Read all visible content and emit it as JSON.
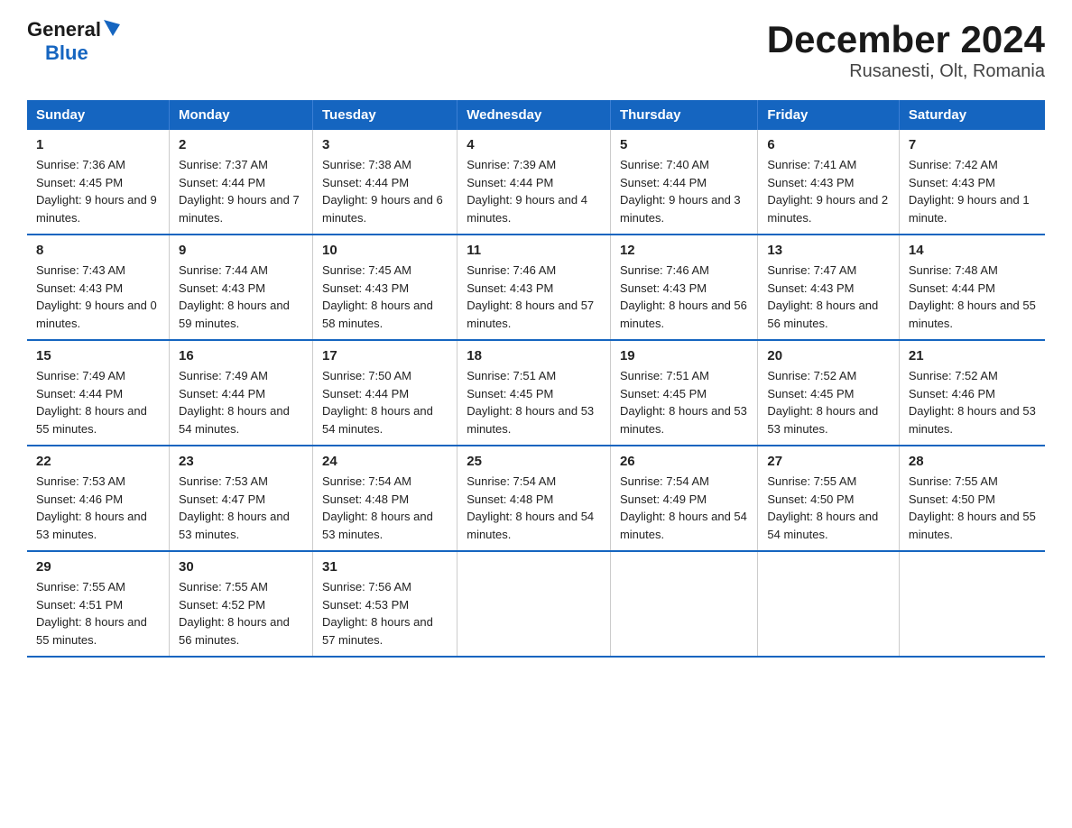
{
  "logo": {
    "general": "General",
    "blue": "Blue"
  },
  "title": "December 2024",
  "subtitle": "Rusanesti, Olt, Romania",
  "headers": [
    "Sunday",
    "Monday",
    "Tuesday",
    "Wednesday",
    "Thursday",
    "Friday",
    "Saturday"
  ],
  "weeks": [
    [
      {
        "day": "1",
        "sunrise": "7:36 AM",
        "sunset": "4:45 PM",
        "daylight": "9 hours and 9 minutes."
      },
      {
        "day": "2",
        "sunrise": "7:37 AM",
        "sunset": "4:44 PM",
        "daylight": "9 hours and 7 minutes."
      },
      {
        "day": "3",
        "sunrise": "7:38 AM",
        "sunset": "4:44 PM",
        "daylight": "9 hours and 6 minutes."
      },
      {
        "day": "4",
        "sunrise": "7:39 AM",
        "sunset": "4:44 PM",
        "daylight": "9 hours and 4 minutes."
      },
      {
        "day": "5",
        "sunrise": "7:40 AM",
        "sunset": "4:44 PM",
        "daylight": "9 hours and 3 minutes."
      },
      {
        "day": "6",
        "sunrise": "7:41 AM",
        "sunset": "4:43 PM",
        "daylight": "9 hours and 2 minutes."
      },
      {
        "day": "7",
        "sunrise": "7:42 AM",
        "sunset": "4:43 PM",
        "daylight": "9 hours and 1 minute."
      }
    ],
    [
      {
        "day": "8",
        "sunrise": "7:43 AM",
        "sunset": "4:43 PM",
        "daylight": "9 hours and 0 minutes."
      },
      {
        "day": "9",
        "sunrise": "7:44 AM",
        "sunset": "4:43 PM",
        "daylight": "8 hours and 59 minutes."
      },
      {
        "day": "10",
        "sunrise": "7:45 AM",
        "sunset": "4:43 PM",
        "daylight": "8 hours and 58 minutes."
      },
      {
        "day": "11",
        "sunrise": "7:46 AM",
        "sunset": "4:43 PM",
        "daylight": "8 hours and 57 minutes."
      },
      {
        "day": "12",
        "sunrise": "7:46 AM",
        "sunset": "4:43 PM",
        "daylight": "8 hours and 56 minutes."
      },
      {
        "day": "13",
        "sunrise": "7:47 AM",
        "sunset": "4:43 PM",
        "daylight": "8 hours and 56 minutes."
      },
      {
        "day": "14",
        "sunrise": "7:48 AM",
        "sunset": "4:44 PM",
        "daylight": "8 hours and 55 minutes."
      }
    ],
    [
      {
        "day": "15",
        "sunrise": "7:49 AM",
        "sunset": "4:44 PM",
        "daylight": "8 hours and 55 minutes."
      },
      {
        "day": "16",
        "sunrise": "7:49 AM",
        "sunset": "4:44 PM",
        "daylight": "8 hours and 54 minutes."
      },
      {
        "day": "17",
        "sunrise": "7:50 AM",
        "sunset": "4:44 PM",
        "daylight": "8 hours and 54 minutes."
      },
      {
        "day": "18",
        "sunrise": "7:51 AM",
        "sunset": "4:45 PM",
        "daylight": "8 hours and 53 minutes."
      },
      {
        "day": "19",
        "sunrise": "7:51 AM",
        "sunset": "4:45 PM",
        "daylight": "8 hours and 53 minutes."
      },
      {
        "day": "20",
        "sunrise": "7:52 AM",
        "sunset": "4:45 PM",
        "daylight": "8 hours and 53 minutes."
      },
      {
        "day": "21",
        "sunrise": "7:52 AM",
        "sunset": "4:46 PM",
        "daylight": "8 hours and 53 minutes."
      }
    ],
    [
      {
        "day": "22",
        "sunrise": "7:53 AM",
        "sunset": "4:46 PM",
        "daylight": "8 hours and 53 minutes."
      },
      {
        "day": "23",
        "sunrise": "7:53 AM",
        "sunset": "4:47 PM",
        "daylight": "8 hours and 53 minutes."
      },
      {
        "day": "24",
        "sunrise": "7:54 AM",
        "sunset": "4:48 PM",
        "daylight": "8 hours and 53 minutes."
      },
      {
        "day": "25",
        "sunrise": "7:54 AM",
        "sunset": "4:48 PM",
        "daylight": "8 hours and 54 minutes."
      },
      {
        "day": "26",
        "sunrise": "7:54 AM",
        "sunset": "4:49 PM",
        "daylight": "8 hours and 54 minutes."
      },
      {
        "day": "27",
        "sunrise": "7:55 AM",
        "sunset": "4:50 PM",
        "daylight": "8 hours and 54 minutes."
      },
      {
        "day": "28",
        "sunrise": "7:55 AM",
        "sunset": "4:50 PM",
        "daylight": "8 hours and 55 minutes."
      }
    ],
    [
      {
        "day": "29",
        "sunrise": "7:55 AM",
        "sunset": "4:51 PM",
        "daylight": "8 hours and 55 minutes."
      },
      {
        "day": "30",
        "sunrise": "7:55 AM",
        "sunset": "4:52 PM",
        "daylight": "8 hours and 56 minutes."
      },
      {
        "day": "31",
        "sunrise": "7:56 AM",
        "sunset": "4:53 PM",
        "daylight": "8 hours and 57 minutes."
      },
      null,
      null,
      null,
      null
    ]
  ]
}
